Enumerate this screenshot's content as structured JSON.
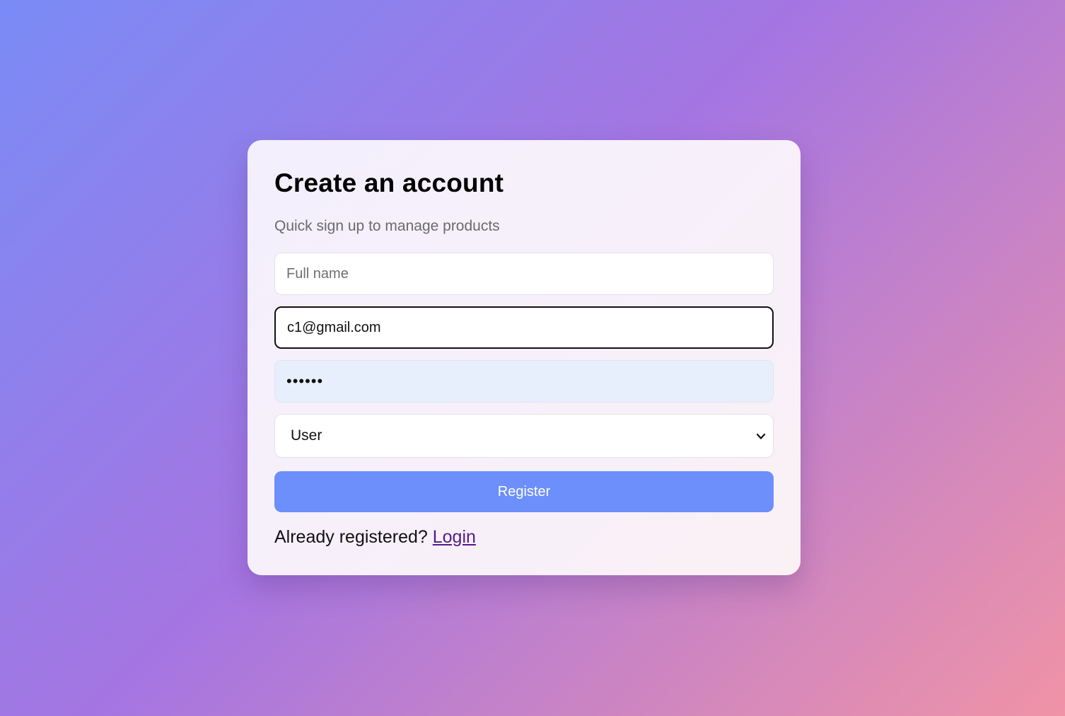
{
  "card": {
    "title": "Create an account",
    "subtitle": "Quick sign up to manage products"
  },
  "form": {
    "name_placeholder": "Full name",
    "name_value": "",
    "email_value": "c1@gmail.com",
    "password_value": "••••••",
    "role_selected": "User",
    "register_label": "Register"
  },
  "footer": {
    "prompt": "Already registered?",
    "login_label": "Login"
  },
  "icons": {
    "select_arrow": "chevron-down-icon"
  },
  "colors": {
    "button": "#6d8ffb",
    "link": "#551a8b",
    "password_fill": "#e8effc"
  }
}
